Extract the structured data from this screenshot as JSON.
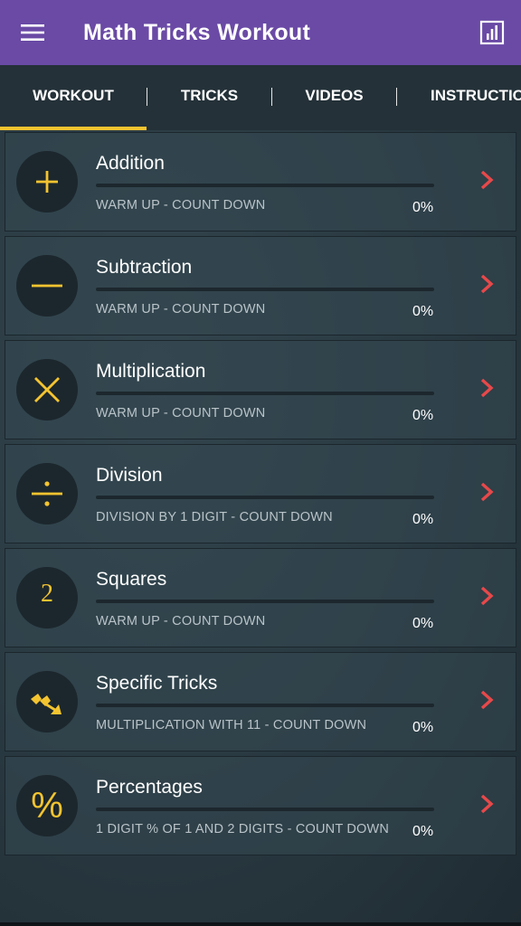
{
  "app_title": "Math Tricks Workout",
  "tabs": [
    {
      "label": "WORKOUT",
      "active": true
    },
    {
      "label": "TRICKS",
      "active": false
    },
    {
      "label": "VIDEOS",
      "active": false
    },
    {
      "label": "INSTRUCTIONS",
      "active": false
    }
  ],
  "colors": {
    "appbar": "#6a4aa5",
    "accent": "#f4c430",
    "chevron": "#e8484a"
  },
  "workouts": [
    {
      "title": "Addition",
      "subtitle": "WARM UP - COUNT DOWN",
      "percent": "0%",
      "progress": 0,
      "icon": "plus-icon",
      "symbol": "+"
    },
    {
      "title": "Subtraction",
      "subtitle": "WARM UP - COUNT DOWN",
      "percent": "0%",
      "progress": 0,
      "icon": "minus-icon",
      "symbol": "−"
    },
    {
      "title": "Multiplication",
      "subtitle": "WARM UP - COUNT DOWN",
      "percent": "0%",
      "progress": 0,
      "icon": "multiply-icon",
      "symbol": "×"
    },
    {
      "title": "Division",
      "subtitle": "DIVISION BY 1 DIGIT - COUNT DOWN",
      "percent": "0%",
      "progress": 0,
      "icon": "divide-icon",
      "symbol": "÷"
    },
    {
      "title": "Squares",
      "subtitle": "WARM UP - COUNT DOWN",
      "percent": "0%",
      "progress": 0,
      "icon": "squares-icon",
      "symbol": "2"
    },
    {
      "title": "Specific Tricks",
      "subtitle": "MULTIPLICATION WITH 11 - COUNT DOWN",
      "percent": "0%",
      "progress": 0,
      "icon": "magic-arrow-icon",
      "symbol": ""
    },
    {
      "title": "Percentages",
      "subtitle": "1 DIGIT % OF 1 AND 2 DIGITS - COUNT DOWN",
      "percent": "0%",
      "progress": 0,
      "icon": "percent-icon",
      "symbol": "%"
    }
  ]
}
